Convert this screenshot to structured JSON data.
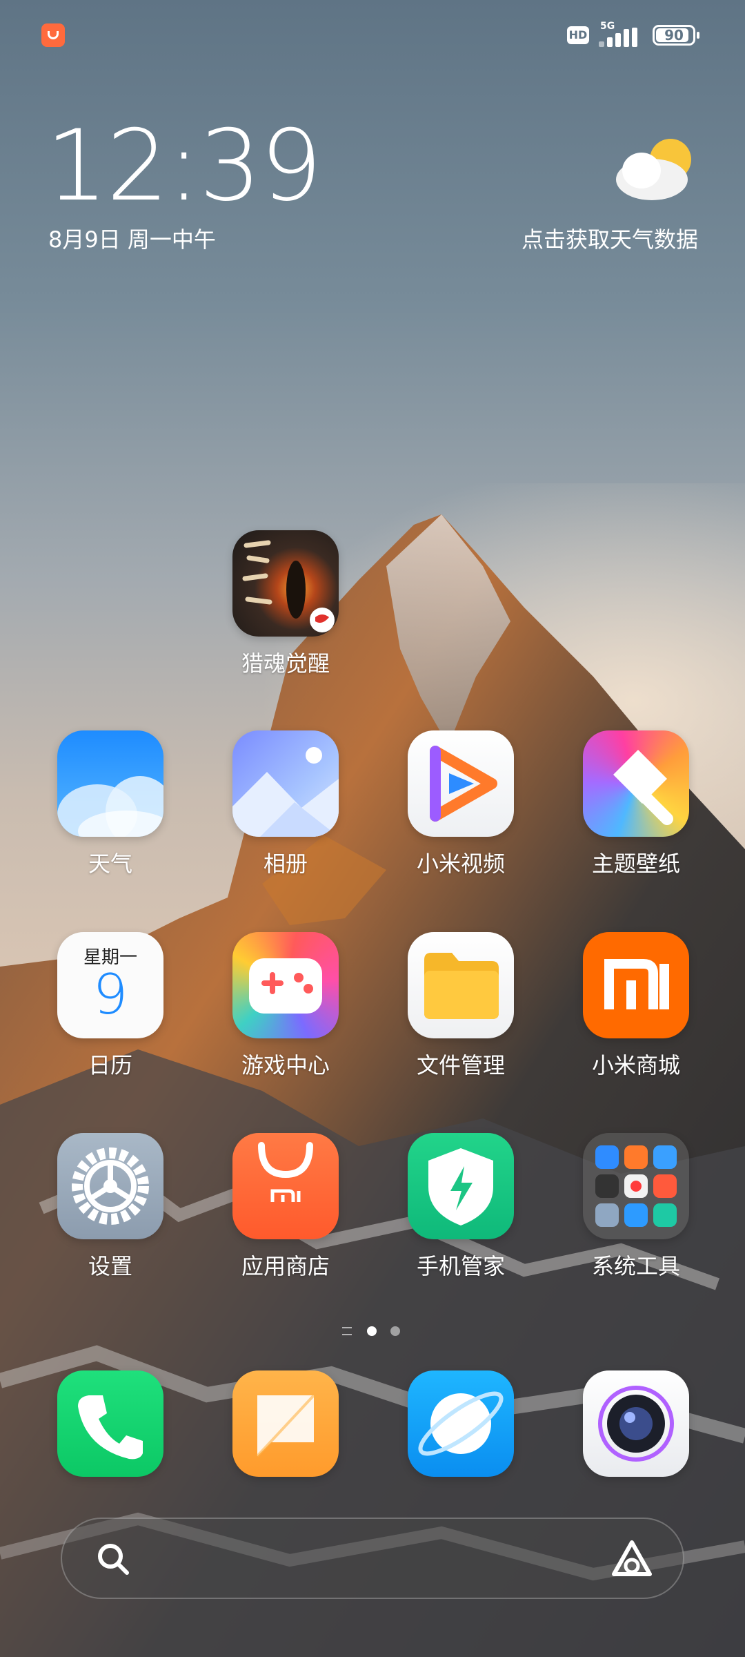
{
  "status_bar": {
    "notification_icon": "mi-store-notification-icon",
    "hd_label": "HD",
    "network_label": "5G",
    "signal_icon": "signal-bars-icon",
    "signal_bars": 4,
    "battery_text": "90",
    "battery_level": 0.9
  },
  "clock": {
    "time": "12:39",
    "date": "8月9日 周一中午"
  },
  "weather_widget": {
    "icon": "partly-sunny-icon",
    "hint": "点击获取天气数据"
  },
  "apps": [
    {
      "label": "猎魂觉醒",
      "icon": "game-dragon-eye-icon"
    },
    {
      "label": "天气",
      "icon": "weather-app-icon"
    },
    {
      "label": "相册",
      "icon": "gallery-icon"
    },
    {
      "label": "小米视频",
      "icon": "video-play-icon"
    },
    {
      "label": "主题壁纸",
      "icon": "themes-brush-icon"
    },
    {
      "label": "日历",
      "icon": "calendar-icon",
      "calendar_weekday": "星期一",
      "calendar_day": "9"
    },
    {
      "label": "游戏中心",
      "icon": "gamepad-icon"
    },
    {
      "label": "文件管理",
      "icon": "folder-icon"
    },
    {
      "label": "小米商城",
      "icon": "mi-logo-icon",
      "logo_text": "mi"
    },
    {
      "label": "设置",
      "icon": "settings-gear-icon"
    },
    {
      "label": "应用商店",
      "icon": "app-store-bag-icon",
      "logo_text": "mi"
    },
    {
      "label": "手机管家",
      "icon": "security-shield-icon"
    },
    {
      "label": "系统工具",
      "icon": "system-tools-folder-icon"
    }
  ],
  "page_indicator": {
    "pages": 2,
    "active_page": 1,
    "active_color": "#ffffff",
    "inactive_color": "rgba(255,255,255,0.5)"
  },
  "dock": [
    {
      "icon": "phone-icon"
    },
    {
      "icon": "messages-icon"
    },
    {
      "icon": "browser-icon"
    },
    {
      "icon": "camera-icon"
    }
  ],
  "search_bar": {
    "search_icon": "search-icon",
    "assistant_icon": "xiao-ai-assistant-icon"
  }
}
